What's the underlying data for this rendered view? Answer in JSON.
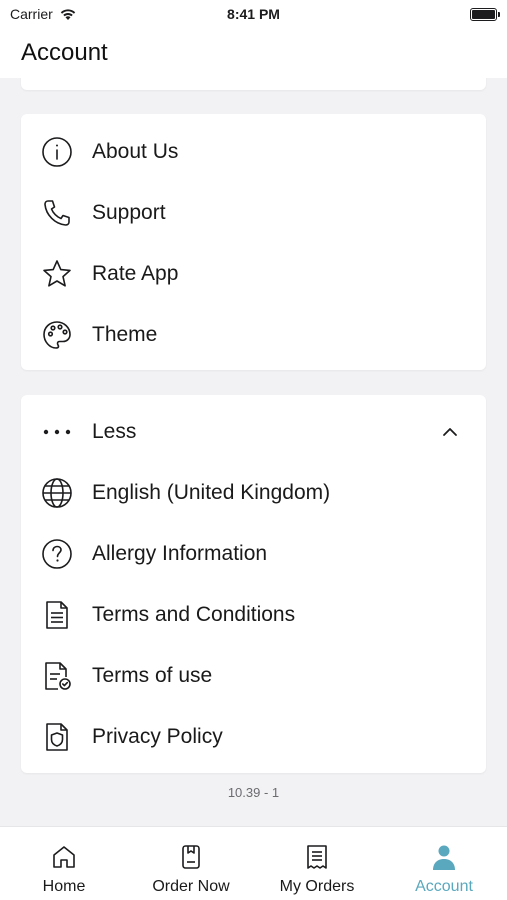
{
  "status_bar": {
    "carrier": "Carrier",
    "time": "8:41 PM"
  },
  "header": {
    "title": "Account"
  },
  "info_card": {
    "items": [
      {
        "label": "About Us",
        "icon": "info-icon"
      },
      {
        "label": "Support",
        "icon": "phone-icon"
      },
      {
        "label": "Rate App",
        "icon": "star-icon"
      },
      {
        "label": "Theme",
        "icon": "palette-icon"
      }
    ]
  },
  "more_card": {
    "toggle_label": "Less",
    "items": [
      {
        "label": "English (United Kingdom)",
        "icon": "globe-icon"
      },
      {
        "label": "Allergy Information",
        "icon": "question-circle-icon"
      },
      {
        "label": "Terms and Conditions",
        "icon": "document-list-icon"
      },
      {
        "label": "Terms of use",
        "icon": "document-check-icon"
      },
      {
        "label": "Privacy Policy",
        "icon": "document-shield-icon"
      }
    ]
  },
  "version": "10.39 - 1",
  "tabbar": {
    "tabs": [
      {
        "label": "Home",
        "icon": "home-icon",
        "active": false
      },
      {
        "label": "Order Now",
        "icon": "order-icon",
        "active": false
      },
      {
        "label": "My Orders",
        "icon": "receipt-icon",
        "active": false
      },
      {
        "label": "Account",
        "icon": "person-icon",
        "active": true
      }
    ]
  },
  "colors": {
    "accent": "#5aa8be",
    "background": "#f2f2f4",
    "card": "#ffffff"
  }
}
